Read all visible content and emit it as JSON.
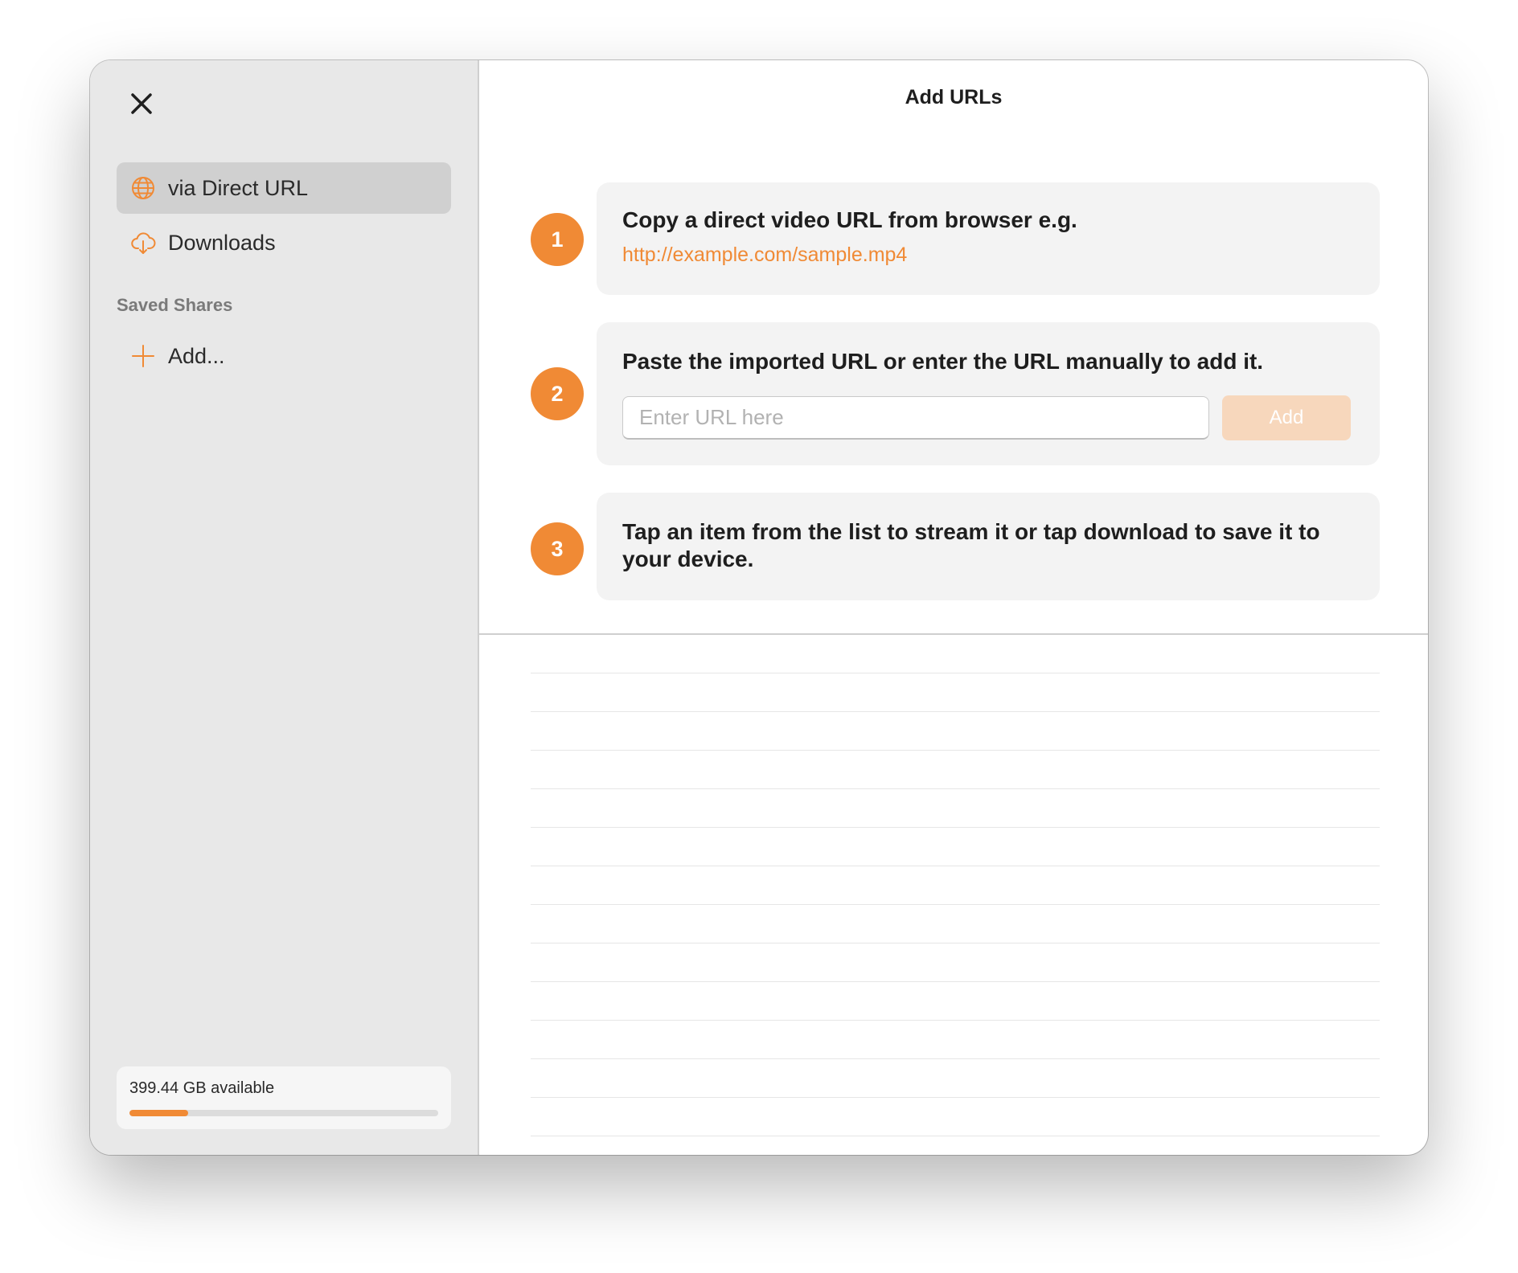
{
  "title": "Add URLs",
  "sidebar": {
    "items": [
      {
        "label": "via Direct URL",
        "icon": "globe-icon",
        "selected": true
      },
      {
        "label": "Downloads",
        "icon": "cloud-download-icon",
        "selected": false
      }
    ],
    "section_title": "Saved Shares",
    "add_label": "Add...",
    "storage": {
      "text": "399.44 GB available",
      "used_fraction": 0.19
    }
  },
  "steps": [
    {
      "number": "1",
      "text": "Copy a direct video URL from browser e.g.",
      "link": "http://example.com/sample.mp4"
    },
    {
      "number": "2",
      "text": "Paste the imported URL or enter the URL manually to add it.",
      "input_placeholder": "Enter URL here",
      "input_value": "",
      "button_label": "Add"
    },
    {
      "number": "3",
      "text": "Tap an item from the list to stream it or tap download to save it to your device."
    }
  ],
  "colors": {
    "accent": "#f08a35",
    "accent_disabled": "#f7d7bc",
    "sidebar_bg": "#e8e8e8",
    "selected_bg": "#d0d0d0",
    "card_bg": "#f3f3f3"
  }
}
